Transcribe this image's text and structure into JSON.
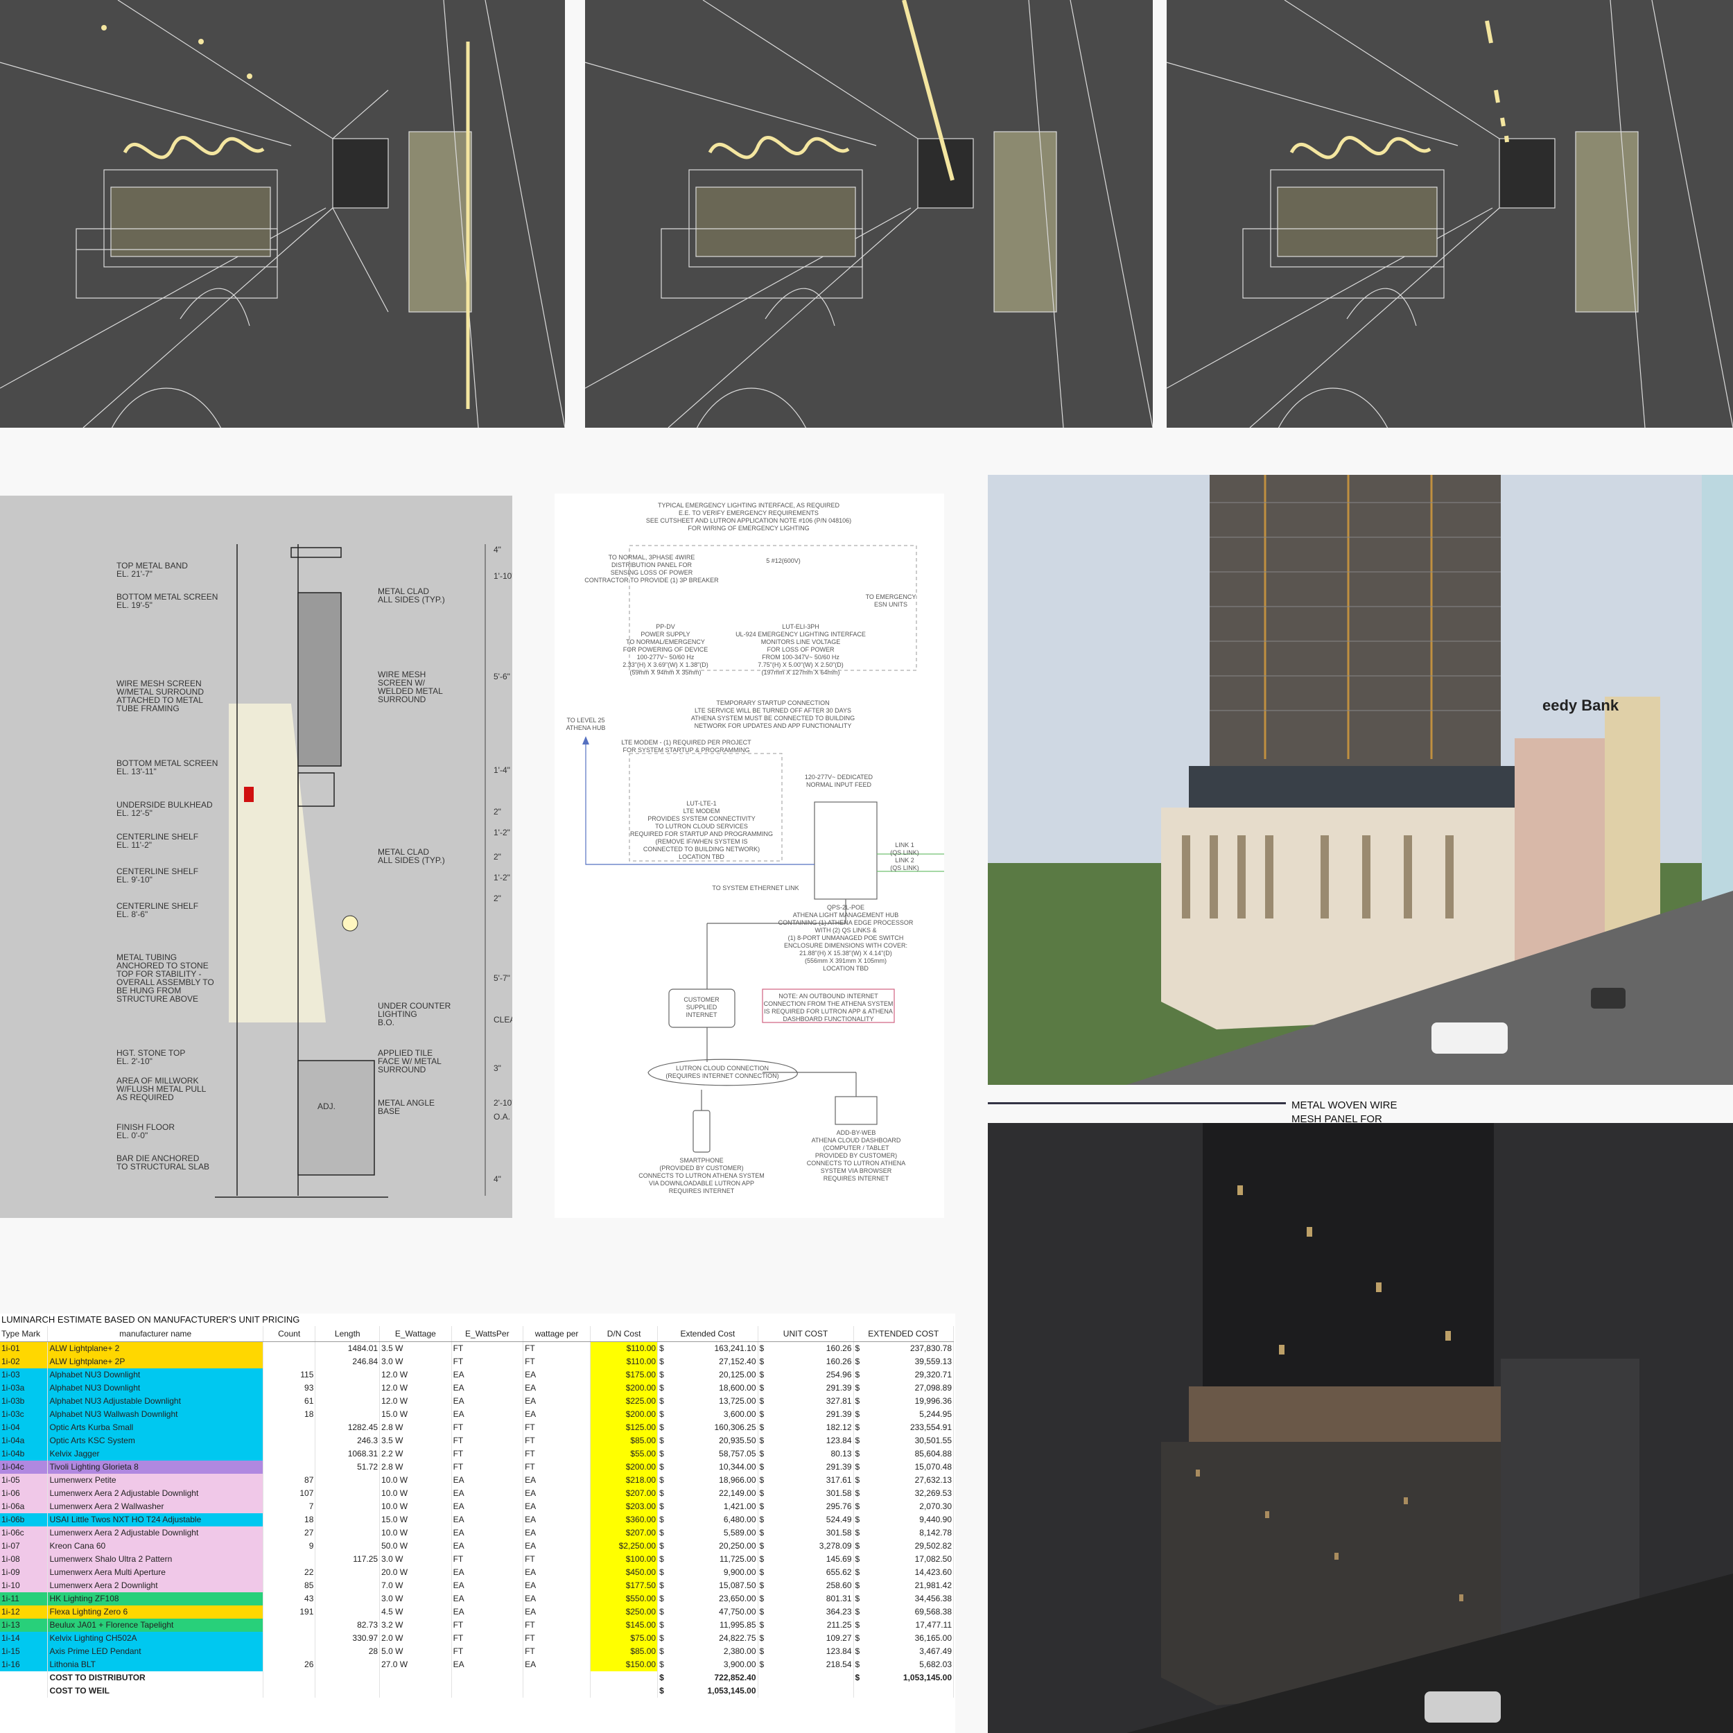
{
  "estimate": {
    "title": "LUMINARCH ESTIMATE BASED ON MANUFACTURER'S UNIT PRICING",
    "headers": [
      "Type Mark",
      "manufacturer name",
      "Count",
      "Length",
      "E_Wattage",
      "E_WattsPer",
      "wattage per",
      "D/N Cost",
      "Extended Cost",
      "UNIT COST",
      "EXTENDED COST"
    ],
    "rows": [
      {
        "mark": "1i-01",
        "name": "ALW Lightplane+ 2",
        "count": "",
        "length": "1484.01",
        "wattage": "3.5 W",
        "wattsper": "FT",
        "wper": "FT",
        "dn": "$110.00",
        "ext": "163,241.10",
        "unit": "160.26",
        "extcost": "237,830.78",
        "color": "#ffd700"
      },
      {
        "mark": "1i-02",
        "name": "ALW Lightplane+ 2P",
        "count": "",
        "length": "246.84",
        "wattage": "3.0 W",
        "wattsper": "FT",
        "wper": "FT",
        "dn": "$110.00",
        "ext": "27,152.40",
        "unit": "160.26",
        "extcost": "39,559.13",
        "color": "#ffd700"
      },
      {
        "mark": "1i-03",
        "name": "Alphabet NU3 Downlight",
        "count": "115",
        "length": "",
        "wattage": "12.0 W",
        "wattsper": "EA",
        "wper": "EA",
        "dn": "$175.00",
        "ext": "20,125.00",
        "unit": "254.96",
        "extcost": "29,320.71",
        "color": "#00c8f0"
      },
      {
        "mark": "1i-03a",
        "name": "Alphabet NU3 Downlight",
        "count": "93",
        "length": "",
        "wattage": "12.0 W",
        "wattsper": "EA",
        "wper": "EA",
        "dn": "$200.00",
        "ext": "18,600.00",
        "unit": "291.39",
        "extcost": "27,098.89",
        "color": "#00c8f0"
      },
      {
        "mark": "1i-03b",
        "name": "Alphabet NU3 Adjustable Downlight",
        "count": "61",
        "length": "",
        "wattage": "12.0 W",
        "wattsper": "EA",
        "wper": "EA",
        "dn": "$225.00",
        "ext": "13,725.00",
        "unit": "327.81",
        "extcost": "19,996.36",
        "color": "#00c8f0"
      },
      {
        "mark": "1i-03c",
        "name": "Alphabet NU3 Wallwash Downlight",
        "count": "18",
        "length": "",
        "wattage": "15.0 W",
        "wattsper": "EA",
        "wper": "EA",
        "dn": "$200.00",
        "ext": "3,600.00",
        "unit": "291.39",
        "extcost": "5,244.95",
        "color": "#00c8f0"
      },
      {
        "mark": "1i-04",
        "name": "Optic Arts Kurba Small",
        "count": "",
        "length": "1282.45",
        "wattage": "2.8 W",
        "wattsper": "FT",
        "wper": "FT",
        "dn": "$125.00",
        "ext": "160,306.25",
        "unit": "182.12",
        "extcost": "233,554.91",
        "color": "#00c8f0"
      },
      {
        "mark": "1i-04a",
        "name": "Optic Arts KSC System",
        "count": "",
        "length": "246.3",
        "wattage": "3.5 W",
        "wattsper": "FT",
        "wper": "FT",
        "dn": "$85.00",
        "ext": "20,935.50",
        "unit": "123.84",
        "extcost": "30,501.55",
        "color": "#00c8f0"
      },
      {
        "mark": "1i-04b",
        "name": "Kelvix Jagger",
        "count": "",
        "length": "1068.31",
        "wattage": "2.2 W",
        "wattsper": "FT",
        "wper": "FT",
        "dn": "$55.00",
        "ext": "58,757.05",
        "unit": "80.13",
        "extcost": "85,604.88",
        "color": "#00c8f0"
      },
      {
        "mark": "1i-04c",
        "name": "Tivoli Lighting Glorieta 8",
        "count": "",
        "length": "51.72",
        "wattage": "2.8 W",
        "wattsper": "FT",
        "wper": "FT",
        "dn": "$200.00",
        "ext": "10,344.00",
        "unit": "291.39",
        "extcost": "15,070.48",
        "color": "#b088e0"
      },
      {
        "mark": "1i-05",
        "name": "Lumenwerx Petite",
        "count": "87",
        "length": "",
        "wattage": "10.0 W",
        "wattsper": "EA",
        "wper": "EA",
        "dn": "$218.00",
        "ext": "18,966.00",
        "unit": "317.61",
        "extcost": "27,632.13",
        "color": "#f0c8e8"
      },
      {
        "mark": "1i-06",
        "name": "Lumenwerx Aera 2 Adjustable Downlight",
        "count": "107",
        "length": "",
        "wattage": "10.0 W",
        "wattsper": "EA",
        "wper": "EA",
        "dn": "$207.00",
        "ext": "22,149.00",
        "unit": "301.58",
        "extcost": "32,269.53",
        "color": "#f0c8e8"
      },
      {
        "mark": "1i-06a",
        "name": "Lumenwerx Aera 2 Wallwasher",
        "count": "7",
        "length": "",
        "wattage": "10.0 W",
        "wattsper": "EA",
        "wper": "EA",
        "dn": "$203.00",
        "ext": "1,421.00",
        "unit": "295.76",
        "extcost": "2,070.30",
        "color": "#f0c8e8"
      },
      {
        "mark": "1i-06b",
        "name": "USAI Little Twos NXT HO T24 Adjustable",
        "count": "18",
        "length": "",
        "wattage": "15.0 W",
        "wattsper": "EA",
        "wper": "EA",
        "dn": "$360.00",
        "ext": "6,480.00",
        "unit": "524.49",
        "extcost": "9,440.90",
        "color": "#00c8f0"
      },
      {
        "mark": "1i-06c",
        "name": "Lumenwerx Aera 2 Adjustable Downlight",
        "count": "27",
        "length": "",
        "wattage": "10.0 W",
        "wattsper": "EA",
        "wper": "EA",
        "dn": "$207.00",
        "ext": "5,589.00",
        "unit": "301.58",
        "extcost": "8,142.78",
        "color": "#f0c8e8"
      },
      {
        "mark": "1i-07",
        "name": "Kreon Cana 60",
        "count": "9",
        "length": "",
        "wattage": "50.0 W",
        "wattsper": "EA",
        "wper": "EA",
        "dn": "$2,250.00",
        "ext": "20,250.00",
        "unit": "3,278.09",
        "extcost": "29,502.82",
        "color": "#f0c8e8"
      },
      {
        "mark": "1i-08",
        "name": "Lumenwerx Shalo Ultra 2 Pattern",
        "count": "",
        "length": "117.25",
        "wattage": "3.0 W",
        "wattsper": "FT",
        "wper": "FT",
        "dn": "$100.00",
        "ext": "11,725.00",
        "unit": "145.69",
        "extcost": "17,082.50",
        "color": "#f0c8e8"
      },
      {
        "mark": "1i-09",
        "name": "Lumenwerx Aera Multi Aperture",
        "count": "22",
        "length": "",
        "wattage": "20.0 W",
        "wattsper": "EA",
        "wper": "EA",
        "dn": "$450.00",
        "ext": "9,900.00",
        "unit": "655.62",
        "extcost": "14,423.60",
        "color": "#f0c8e8"
      },
      {
        "mark": "1i-10",
        "name": "Lumenwerx Aera 2 Downlight",
        "count": "85",
        "length": "",
        "wattage": "7.0 W",
        "wattsper": "EA",
        "wper": "EA",
        "dn": "$177.50",
        "ext": "15,087.50",
        "unit": "258.60",
        "extcost": "21,981.42",
        "color": "#f0c8e8"
      },
      {
        "mark": "1i-11",
        "name": "HK Lighting ZF108",
        "count": "43",
        "length": "",
        "wattage": "3.0 W",
        "wattsper": "EA",
        "wper": "EA",
        "dn": "$550.00",
        "ext": "23,650.00",
        "unit": "801.31",
        "extcost": "34,456.38",
        "color": "#28d07a"
      },
      {
        "mark": "1i-12",
        "name": "Flexa Lighting Zero 6",
        "count": "191",
        "length": "",
        "wattage": "4.5 W",
        "wattsper": "EA",
        "wper": "EA",
        "dn": "$250.00",
        "ext": "47,750.00",
        "unit": "364.23",
        "extcost": "69,568.38",
        "color": "#ffd700"
      },
      {
        "mark": "1i-13",
        "name": "Beulux JA01 + Florence Tapelight",
        "count": "",
        "length": "82.73",
        "wattage": "3.2 W",
        "wattsper": "FT",
        "wper": "FT",
        "dn": "$145.00",
        "ext": "11,995.85",
        "unit": "211.25",
        "extcost": "17,477.11",
        "color": "#28d07a"
      },
      {
        "mark": "1i-14",
        "name": "Kelvix Lighting CH502A",
        "count": "",
        "length": "330.97",
        "wattage": "2.0 W",
        "wattsper": "FT",
        "wper": "FT",
        "dn": "$75.00",
        "ext": "24,822.75",
        "unit": "109.27",
        "extcost": "36,165.00",
        "color": "#00c8f0"
      },
      {
        "mark": "1i-15",
        "name": "Axis Prime LED Pendant",
        "count": "",
        "length": "28",
        "wattage": "5.0 W",
        "wattsper": "FT",
        "wper": "FT",
        "dn": "$85.00",
        "ext": "2,380.00",
        "unit": "123.84",
        "extcost": "3,467.49",
        "color": "#00c8f0"
      },
      {
        "mark": "1i-16",
        "name": "Lithonia BLT",
        "count": "26",
        "length": "",
        "wattage": "27.0 W",
        "wattsper": "EA",
        "wper": "EA",
        "dn": "$150.00",
        "ext": "3,900.00",
        "unit": "218.54",
        "extcost": "5,682.03",
        "color": "#00c8f0"
      }
    ],
    "summary": [
      {
        "label": "COST TO DISTRIBUTOR",
        "ext": "722,852.40",
        "extcost": "1,053,145.00"
      },
      {
        "label": "COST TO WEIL",
        "ext": "1,053,145.00",
        "extcost": ""
      }
    ],
    "currency": "$"
  },
  "callout": {
    "line1": "METAL WOVEN WIRE",
    "line2": "MESH PANEL FOR"
  },
  "detail": {
    "labels": [
      "TOP METAL BAND",
      "EL. 21'-7\"",
      "BOTTOM METAL SCREEN",
      "EL. 19'-5\"",
      "WIRE MESH SCREEN",
      "W/METAL SURROUND",
      "ATTACHED TO METAL",
      "TUBE FRAMING",
      "BOTTOM METAL SCREEN",
      "EL. 13'-11\"",
      "UNDERSIDE BULKHEAD",
      "EL. 12'-5\"",
      "CENTERLINE SHELF",
      "EL. 11'-2\"",
      "CENTERLINE SHELF",
      "EL. 9'-10\"",
      "CENTERLINE SHELF",
      "EL. 8'-6\"",
      "METAL TUBING",
      "ANCHORED TO STONE",
      "TOP FOR STABILITY -",
      "OVERALL ASSEMBLY TO",
      "BE HUNG FROM",
      "STRUCTURE ABOVE",
      "HGT. STONE TOP",
      "EL. 2'-10\"",
      "AREA OF MILLWORK",
      "W/FLUSH METAL PULL",
      "AS REQUIRED",
      "FINISH FLOOR",
      "EL. 0'-0\"",
      "BAR DIE ANCHORED",
      "TO STRUCTURAL SLAB"
    ],
    "right_labels": [
      "METAL CLAD",
      "ALL SIDES (TYP.)",
      "WIRE MESH",
      "SCREEN W/",
      "WELDED METAL",
      "SURROUND",
      "METAL CLAD",
      "ALL SIDES (TYP.)",
      "UNDER COUNTER",
      "LIGHTING",
      "B.O.",
      "APPLIED TILE",
      "FACE W/ METAL",
      "SURROUND",
      "METAL ANGLE",
      "BASE"
    ],
    "dims": [
      "4\"",
      "1'-10\"",
      "5'-6\"",
      "1'-4\"",
      "2\"",
      "1'-2\"",
      "2\"",
      "1'-2\"",
      "2\"",
      "5'-7\"",
      "CLEAR DIMENSION",
      "3\"",
      "2'-10\"",
      "O.A.",
      "4\""
    ],
    "adj_label": "ADJ."
  },
  "diagram": {
    "top_note": [
      "TYPICAL EMERGENCY LIGHTING INTERFACE, AS REQUIRED",
      "E.E. TO VERIFY EMERGENCY REQUIREMENTS",
      "SEE CUTSHEET AND LUTRON APPLICATION NOTE #106 (P/N 048106)",
      "FOR WIRING OF EMERGENCY LIGHTING"
    ],
    "normal_note": [
      "TO NORMAL, 3PHASE 4WIRE",
      "DISTRIBUTION PANEL FOR",
      "SENSING LOSS OF POWER",
      "CONTRACTOR TO PROVIDE (1) 3P BREAKER"
    ],
    "power_supply": [
      "PP-DV",
      "POWER SUPPLY",
      "TO NORMAL/EMERGENCY",
      "FOR POWERING OF DEVICE",
      "100-277V~ 50/60 Hz",
      "2.33\"(H) X 3.69\"(W) X 1.38\"(D)",
      "(59mm X 94mm X 35mm)"
    ],
    "elii": [
      "LUT-ELI-3PH",
      "UL-924 EMERGENCY LIGHTING INTERFACE",
      "MONITORS LINE VOLTAGE",
      "FOR LOSS OF POWER",
      "FROM 100-347V~ 50/60 Hz",
      "7.75\"(H) X 5.00\"(W) X 2.50\"(D)",
      "(197mm X 127mm X 64mm)"
    ],
    "esn": [
      "TO EMERGENCY",
      "ESN UNITS"
    ],
    "wire_label": "5 #12(600V)",
    "startup_note": [
      "TEMPORARY STARTUP CONNECTION",
      "LTE SERVICE WILL BE TURNED OFF AFTER 30 DAYS",
      "ATHENA SYSTEM MUST BE CONNECTED TO BUILDING",
      "NETWORK FOR UPDATES AND APP FUNCTIONALITY"
    ],
    "to_level": [
      "TO LEVEL 25",
      "ATHENA HUB"
    ],
    "modem_note": [
      "LTE MODEM - (1) REQUIRED PER PROJECT",
      "FOR SYSTEM STARTUP & PROGRAMMING"
    ],
    "modem": [
      "LUT-LTE-1",
      "LTE MODEM",
      "PROVIDES SYSTEM CONNECTIVITY",
      "TO LUTRON CLOUD SERVICES",
      "REQUIRED FOR STARTUP AND PROGRAMMING",
      "(REMOVE IF/WHEN SYSTEM IS",
      "CONNECTED TO BUILDING NETWORK)",
      "LOCATION TBD"
    ],
    "feed": [
      "120-277V~ DEDICATED",
      "NORMAL INPUT FEED"
    ],
    "links": [
      "LINK 1",
      "(QS LINK)",
      "LINK 2",
      "(QS LINK)"
    ],
    "eth_label": "TO SYSTEM ETHERNET LINK",
    "hub": [
      "QPS-2L-POE",
      "ATHENA LIGHT MANAGEMENT HUB",
      "CONTAINING (1) ATHENA EDGE PROCESSOR",
      "WITH (2) QS LINKS &",
      "(1) 8-PORT UNMANAGED POE SWITCH",
      "ENCLOSURE DIMENSIONS WITH COVER:",
      "21.88\"(H) X 15.38\"(W) X 4.14\"(D)",
      "(556mm X 391mm X 105mm)",
      "LOCATION TBD"
    ],
    "internet": [
      "CUSTOMER",
      "SUPPLIED",
      "INTERNET"
    ],
    "internet_note": [
      "NOTE: AN OUTBOUND INTERNET",
      "CONNECTION FROM THE ATHENA SYSTEM",
      "IS REQUIRED FOR LUTRON APP & ATHENA",
      "DASHBOARD FUNCTIONALITY"
    ],
    "cloud": [
      "LUTRON CLOUD CONNECTION",
      "(REQUIRES INTERNET CONNECTION)"
    ],
    "phone": [
      "SMARTPHONE",
      "(PROVIDED BY CUSTOMER)",
      "CONNECTS TO LUTRON ATHENA SYSTEM",
      "VIA DOWNLOADABLE LUTRON APP",
      "REQUIRES INTERNET"
    ],
    "dashboard": [
      "ADD-BY-WEB",
      "ATHENA CLOUD DASHBOARD",
      "(COMPUTER / TABLET",
      "PROVIDED BY CUSTOMER)",
      "CONNECTS TO LUTRON ATHENA",
      "SYSTEM VIA BROWSER",
      "REQUIRES INTERNET"
    ]
  },
  "day_sign": "eedy Bank",
  "colors": {
    "render_bg": "#4a4a4a",
    "line": "#e8e8e8",
    "glow": "#f4e6a0",
    "highlight": "#ffff00",
    "accent_red": "#d01010"
  }
}
